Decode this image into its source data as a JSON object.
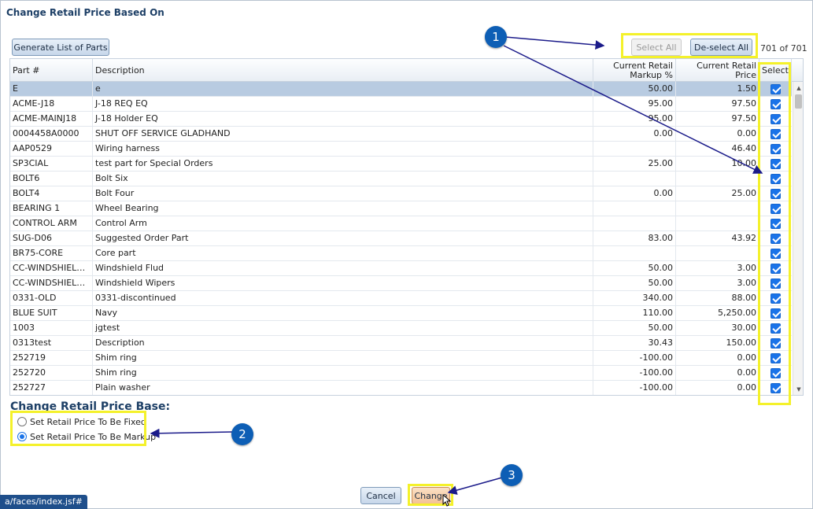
{
  "dialog": {
    "title": "Change Retail Price Based On"
  },
  "toolbar": {
    "generate_label": "Generate List of Parts",
    "select_all_label": "Select All",
    "deselect_all_label": "De-select All",
    "count_text": "701 of 701"
  },
  "table": {
    "headers": {
      "part": "Part #",
      "description": "Description",
      "markup_line1": "Current Retail",
      "markup_line2": "Markup %",
      "price": "Current Retail Price",
      "select": "Select"
    },
    "rows": [
      {
        "part": "E",
        "description": "e",
        "markup": "50.00",
        "price": "1.50",
        "selected": true
      },
      {
        "part": "ACME-J18",
        "description": "J-18 REQ EQ",
        "markup": "95.00",
        "price": "97.50",
        "selected": true
      },
      {
        "part": "ACME-MAINJ18",
        "description": "J-18 Holder EQ",
        "markup": "95.00",
        "price": "97.50",
        "selected": true
      },
      {
        "part": "0004458A0000",
        "description": "SHUT OFF SERVICE GLADHAND",
        "markup": "0.00",
        "price": "0.00",
        "selected": true
      },
      {
        "part": "AAP0529",
        "description": "Wiring harness",
        "markup": "",
        "price": "46.40",
        "selected": true
      },
      {
        "part": "SP3CIAL",
        "description": "test part for Special Orders",
        "markup": "25.00",
        "price": "10.00",
        "selected": true
      },
      {
        "part": "BOLT6",
        "description": "Bolt Six",
        "markup": "",
        "price": "",
        "selected": true
      },
      {
        "part": "BOLT4",
        "description": "Bolt Four",
        "markup": "0.00",
        "price": "25.00",
        "selected": true
      },
      {
        "part": "BEARING 1",
        "description": "Wheel Bearing",
        "markup": "",
        "price": "",
        "selected": true
      },
      {
        "part": "CONTROL ARM",
        "description": "Control Arm",
        "markup": "",
        "price": "",
        "selected": true
      },
      {
        "part": "SUG-D06",
        "description": "Suggested Order Part",
        "markup": "83.00",
        "price": "43.92",
        "selected": true
      },
      {
        "part": "BR75-CORE",
        "description": "Core part",
        "markup": "",
        "price": "",
        "selected": true
      },
      {
        "part": "CC-WINDSHIELDF...",
        "description": "Windshield Flud",
        "markup": "50.00",
        "price": "3.00",
        "selected": true
      },
      {
        "part": "CC-WINDSHIELD...",
        "description": "Windshield Wipers",
        "markup": "50.00",
        "price": "3.00",
        "selected": true
      },
      {
        "part": "0331-OLD",
        "description": "0331-discontinued",
        "markup": "340.00",
        "price": "88.00",
        "selected": true
      },
      {
        "part": "BLUE SUIT",
        "description": "Navy",
        "markup": "110.00",
        "price": "5,250.00",
        "selected": true
      },
      {
        "part": "1003",
        "description": "jgtest",
        "markup": "50.00",
        "price": "30.00",
        "selected": true
      },
      {
        "part": "0313test",
        "description": "Description",
        "markup": "30.43",
        "price": "150.00",
        "selected": true
      },
      {
        "part": "252719",
        "description": "Shim ring",
        "markup": "-100.00",
        "price": "0.00",
        "selected": true
      },
      {
        "part": "252720",
        "description": "Shim ring",
        "markup": "-100.00",
        "price": "0.00",
        "selected": true
      },
      {
        "part": "252727",
        "description": "Plain washer",
        "markup": "-100.00",
        "price": "0.00",
        "selected": true
      }
    ]
  },
  "price_base": {
    "title": "Change Retail Price Base:",
    "option_fixed": "Set Retail Price To Be Fixed",
    "option_markup": "Set Retail Price To Be Markup",
    "selected": "markup"
  },
  "footer": {
    "cancel_label": "Cancel",
    "change_label": "Change"
  },
  "status_bar": {
    "url_text": "a/faces/index.jsf#"
  },
  "annotations": {
    "badge1": "1",
    "badge2": "2",
    "badge3": "3",
    "highlight_color": "#f4f12a",
    "badge_color": "#0d5eb5",
    "arrow_color": "#1b1b8a"
  }
}
